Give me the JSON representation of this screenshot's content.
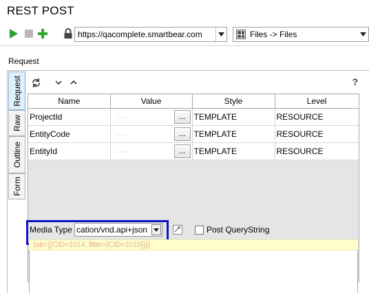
{
  "window": {
    "title": "REST POST"
  },
  "toolbar": {
    "url": "https://qacomplete.smartbear.com",
    "method": "Files -> Files",
    "icons": [
      "play-icon",
      "stop-icon",
      "add-icon",
      "lock-icon"
    ]
  },
  "panel": {
    "label": "Request"
  },
  "vertical_tabs": [
    "Request",
    "Raw",
    "Outline",
    "Form"
  ],
  "inner_toolbar": {
    "help": "?"
  },
  "params_table": {
    "columns": [
      "Name",
      "Value",
      "Style",
      "Level"
    ],
    "rows": [
      {
        "name": "ProjectId",
        "value": "·····",
        "style": "TEMPLATE",
        "level": "RESOURCE"
      },
      {
        "name": "EntityCode",
        "value": "·····",
        "style": "TEMPLATE",
        "level": "RESOURCE"
      },
      {
        "name": "EntityId",
        "value": "·····",
        "style": "TEMPLATE",
        "level": "RESOURCE"
      }
    ],
    "ellipsis_label": "..."
  },
  "media": {
    "label": "Media Type",
    "value": "cation/vnd.api+json",
    "post_querystring_label": "Post QueryString",
    "post_querystring_checked": false
  },
  "body": {
    "first_line": "{ab={{CID=1014, filter={CID=1015}}}}"
  },
  "colors": {
    "highlight_border": "#1010c8",
    "active_tab": "#dff0fb",
    "play": "#2ea22e",
    "plus": "#2ea22e"
  }
}
